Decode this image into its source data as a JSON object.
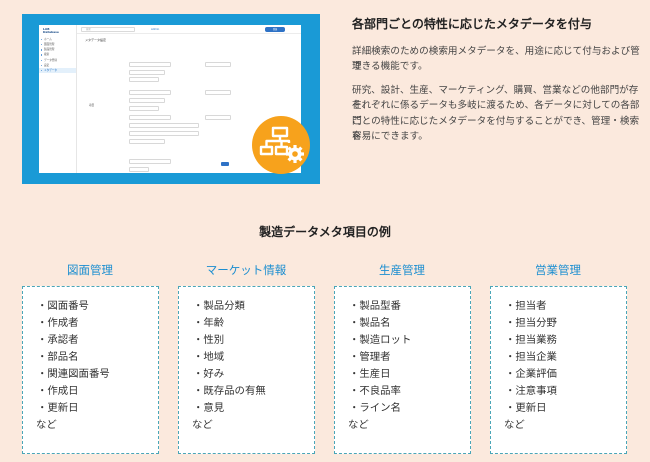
{
  "screenshot": {
    "logo": "LAB\nDatabase",
    "nav": [
      "ホーム",
      "図面管理",
      "製品管理",
      "検索",
      "データ登録",
      "設定",
      "メタデータ"
    ],
    "nav_active_index": 6,
    "search_placeholder": "検索",
    "brand": "Admin",
    "action_button": "登録",
    "page_title": "メタデータ設定",
    "group_label": "項目"
  },
  "icon": {
    "name": "flowchart-gear-icon",
    "bg_color": "#f7a21c"
  },
  "heading": "各部門ごとの特性に応じたメタデータを付与",
  "description": [
    [
      "詳細検索のための検索用メタデータを、用途に応じて付与および管理",
      "できる機能です。"
    ],
    [
      "研究、設計、生産、マーケティング、購買、営業などの他部門が存在、",
      "それぞれに係るデータも多岐に渡るため、各データに対しての各部門",
      "ごとの特性に応じたメタデータを付与することができ、管理・検索を",
      "容易にできます。"
    ]
  ],
  "section_title": "製造データメタ項目の例",
  "categories": [
    {
      "title": "図面管理",
      "items": [
        "・図面番号",
        "・作成者",
        "・承認者",
        "・部品名",
        "・関連図面番号",
        "・作成日",
        "・更新日"
      ],
      "etc": "など"
    },
    {
      "title": "マーケット情報",
      "items": [
        "・製品分類",
        "・年齢",
        "・性別",
        "・地域",
        "・好み",
        "・既存品の有無",
        "・意見"
      ],
      "etc": "など"
    },
    {
      "title": "生産管理",
      "items": [
        "・製品型番",
        "・製品名",
        "・製造ロット",
        "・管理者",
        "・生産日",
        "・不良品率",
        "・ライン名"
      ],
      "etc": "など"
    },
    {
      "title": "営業管理",
      "items": [
        "・担当者",
        "・担当分野",
        "・担当業務",
        "・担当企業",
        "・企業評価",
        "・注意事項",
        "・更新日"
      ],
      "etc": "など"
    }
  ],
  "colors": {
    "background": "#fbe9dd",
    "panel": "#1a9ad6",
    "accent": "#1c8ed0",
    "box_border": "#4aa6b8"
  }
}
